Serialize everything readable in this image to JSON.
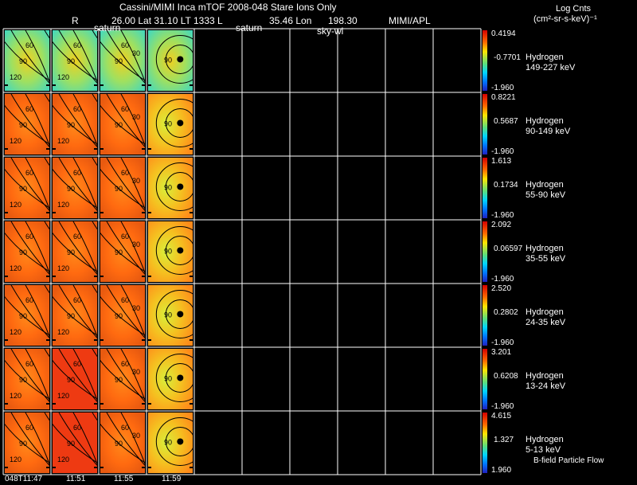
{
  "header": {
    "title": "Cassini/MIMI Inca mTOF  2008-048   Stare    Ions Only",
    "subtitle_r": "R",
    "subtitle_coords": "26.00 Lat 31.10 LT 1333 L",
    "subtitle_lon": "35.46 Lon",
    "subtitle_lon_val": "198.30",
    "subtitle_credit": "MIMI/APL",
    "saturn_label_1": "saturn",
    "saturn_label_2": "saturn",
    "sky_label": "sky-wl"
  },
  "colorbar_header": {
    "title": "Log Cnts",
    "units": "(cm²-sr-s-keV)⁻¹"
  },
  "rows": [
    {
      "species": "Hydrogen",
      "energy": "149-227 keV",
      "max": "0.4194",
      "mid": "-0.7701",
      "min": "-1.960"
    },
    {
      "species": "Hydrogen",
      "energy": "90-149 keV",
      "max": "0.8221",
      "mid": "0.5687",
      "min": "-1.960"
    },
    {
      "species": "Hydrogen",
      "energy": "55-90 keV",
      "max": "1.613",
      "mid": "0.1734",
      "min": "-1.960"
    },
    {
      "species": "Hydrogen",
      "energy": "35-55 keV",
      "max": "2.092",
      "mid": "0.06597",
      "min": "-1.960"
    },
    {
      "species": "Hydrogen",
      "energy": "24-35 keV",
      "max": "2.520",
      "mid": "0.2802",
      "min": "-1.960"
    },
    {
      "species": "Hydrogen",
      "energy": "13-24 keV",
      "max": "3.201",
      "mid": "0.6208",
      "min": "-1.960"
    },
    {
      "species": "Hydrogen",
      "energy": "5-13 keV",
      "max": "4.615",
      "mid": "1.327",
      "min": "1.960"
    }
  ],
  "times": [
    "048T11:47",
    "11:51",
    "11:55",
    "11:59"
  ],
  "contour_labels": [
    "60",
    "90",
    "120",
    "30",
    "90"
  ],
  "footer_label": "B-field Particle Flow"
}
